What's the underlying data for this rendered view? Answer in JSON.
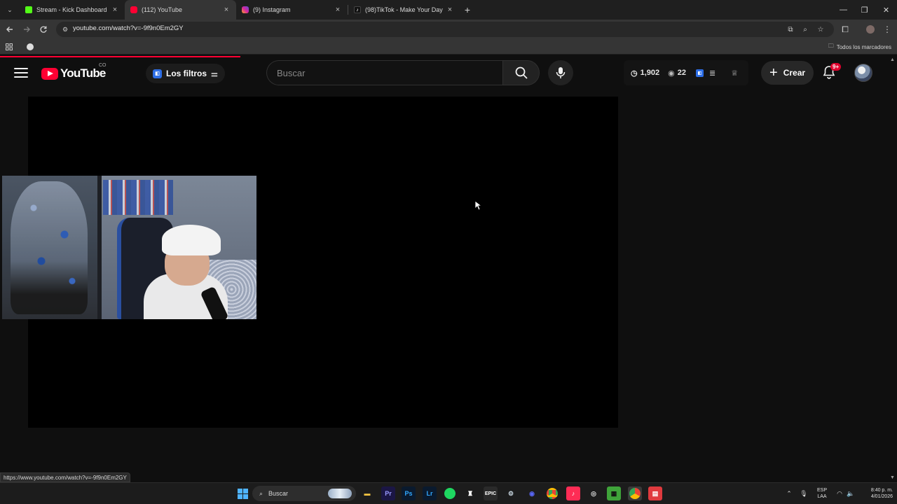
{
  "browser": {
    "tabs": [
      {
        "title": "Stream - Kick Dashboard",
        "favicon_color": "#53fc18",
        "favicon": "kick-icon",
        "active": false
      },
      {
        "title": "(112) YouTube",
        "favicon_color": "#ff0033",
        "favicon": "youtube-icon",
        "active": true
      },
      {
        "title": "(9) Instagram",
        "favicon_color": "#d6249f",
        "favicon": "instagram-icon",
        "active": false
      },
      {
        "title": "(98)TikTok - Make Your Day",
        "favicon_color": "#111111",
        "favicon": "tiktok-icon",
        "active": false
      }
    ],
    "close_glyph": "×",
    "new_tab_glyph": "+",
    "url": "youtube.com/watch?v=-9f9n0Em2GY",
    "bookmarks_folder": "Todos los marcadores",
    "status_url": "https://www.youtube.com/watch?v=-9f9n0Em2GY"
  },
  "youtube": {
    "logo_text": "YouTube",
    "country_code": "CO",
    "filters_label": "Los filtros",
    "search_placeholder": "Buscar",
    "stats": {
      "time": "1,902",
      "views": "22"
    },
    "create_label": "Crear",
    "notifications_badge": "9+",
    "accent_color": "#ff0033"
  },
  "taskbar": {
    "search_label": "Buscar",
    "apps": [
      "file-explorer",
      "premiere",
      "photoshop",
      "lightroom",
      "spotify",
      "app",
      "epic-games",
      "steam",
      "discord",
      "chrome",
      "tiktok-live",
      "obs",
      "minecraft",
      "chrome-profile",
      "app-red"
    ],
    "lang_top": "ESP",
    "lang_bottom": "LAA",
    "time": "8:40 p. m.",
    "date": "4/01/2026"
  }
}
